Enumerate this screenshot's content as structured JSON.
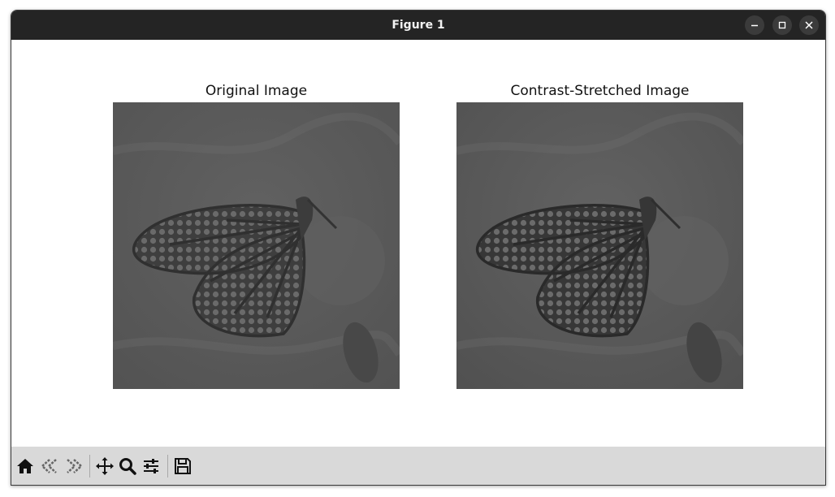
{
  "window": {
    "title": "Figure 1",
    "controls": [
      "minimize-icon",
      "maximize-icon",
      "close-icon"
    ]
  },
  "figure": {
    "panels": [
      {
        "title": "Original Image"
      },
      {
        "title": "Contrast-Stretched Image"
      }
    ]
  },
  "toolbar": {
    "buttons": [
      "home-icon",
      "back-icon",
      "forward-icon",
      "pan-icon",
      "zoom-icon",
      "configure-subplots-icon",
      "save-icon"
    ]
  },
  "colors": {
    "titlebar": "#242424",
    "toolbar": "#d9d9d9",
    "original_bg": "#585858",
    "stretched_bg": "#575757"
  }
}
